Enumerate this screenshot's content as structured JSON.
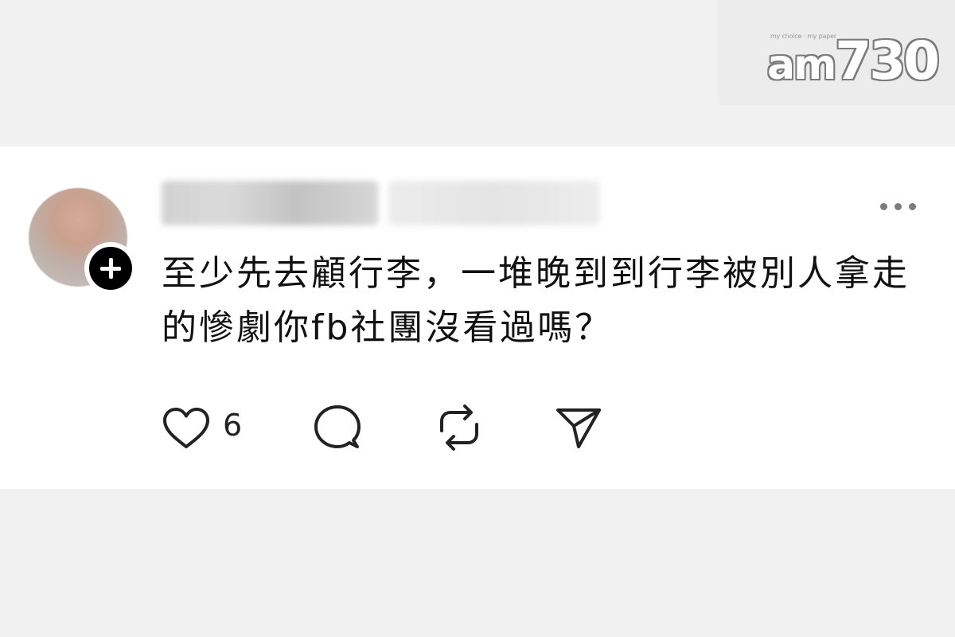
{
  "branding": {
    "logo_text": "am730",
    "logo_main": "am730",
    "logo_tagline": "my choice · my paper"
  },
  "post": {
    "text": "至少先去顧行李，一堆晚到到行李被別人拿走的慘劇你fb社團沒看過嗎？",
    "like_count": "6"
  },
  "icons": {
    "avatar": "blurred-avatar",
    "follow": "plus-icon",
    "more": "ellipsis-icon",
    "like": "heart-icon",
    "comment": "speech-bubble-icon",
    "repost": "repost-icon",
    "share": "paper-plane-icon"
  },
  "colors": {
    "page_background": "#f1f1f1",
    "card_background": "#ffffff",
    "text": "#111111",
    "icon": "#222222",
    "muted": "#7c7c7c"
  }
}
